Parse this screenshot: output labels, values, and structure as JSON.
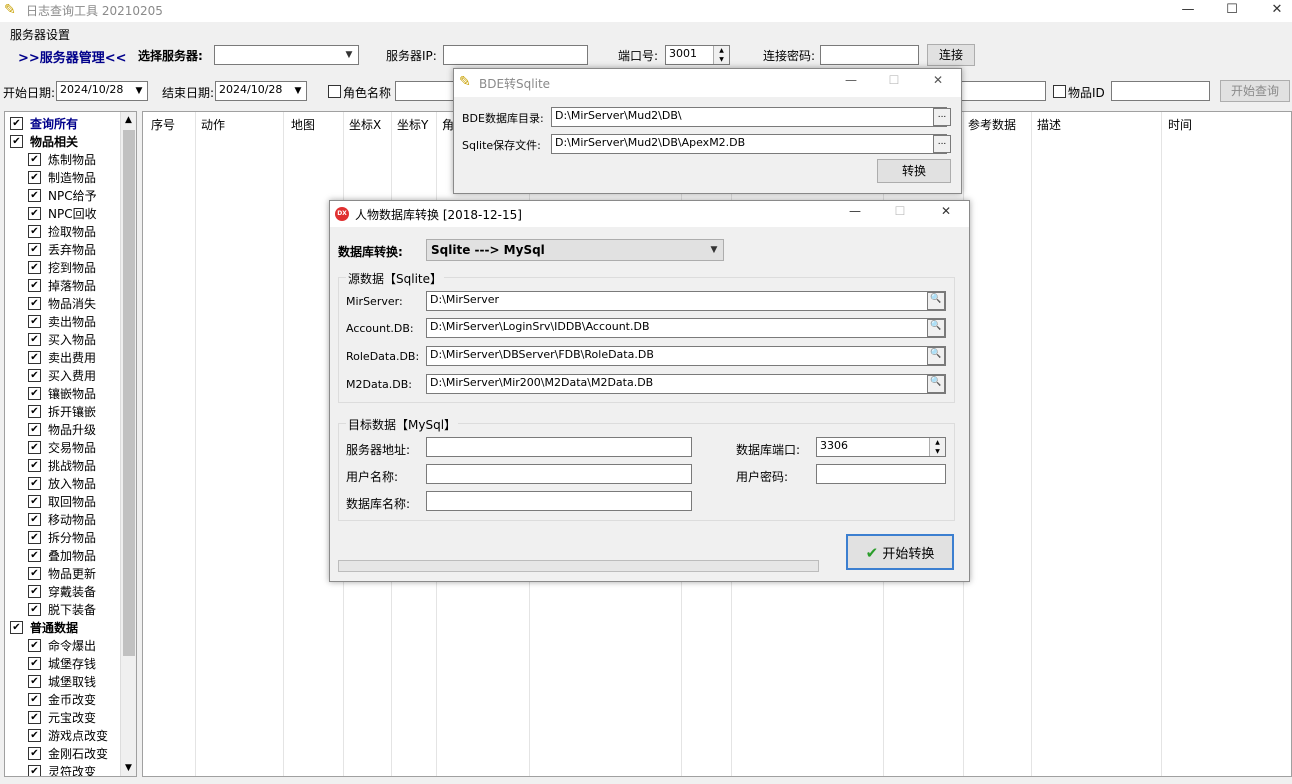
{
  "app": {
    "title": "日志查询工具 20210205",
    "menu": [
      "服务器设置"
    ]
  },
  "toolbar": {
    "server_mgmt_link": ">>服务器管理<<",
    "select_server_label": "选择服务器:",
    "select_server_value": "",
    "server_ip_label": "服务器IP:",
    "server_ip_value": "",
    "port_label": "端口号:",
    "port_value": "3001",
    "password_label": "连接密码:",
    "password_value": "",
    "connect_button": "连接"
  },
  "filters": {
    "start_date_label": "开始日期:",
    "start_date_value": "2024/10/28",
    "end_date_label": "结束日期:",
    "end_date_value": "2024/10/28",
    "role_name_label": "角色名称",
    "item_id_label": "物品ID",
    "query_button": "开始查询"
  },
  "tree": {
    "items": [
      {
        "label": "查询所有",
        "level": 0,
        "checked": true,
        "style": "root-blue"
      },
      {
        "label": "物品相关",
        "level": 0,
        "checked": true,
        "style": "group"
      },
      {
        "label": "炼制物品",
        "level": 1,
        "checked": true
      },
      {
        "label": "制造物品",
        "level": 1,
        "checked": true
      },
      {
        "label": "NPC给予",
        "level": 1,
        "checked": true
      },
      {
        "label": "NPC回收",
        "level": 1,
        "checked": true
      },
      {
        "label": "捡取物品",
        "level": 1,
        "checked": true
      },
      {
        "label": "丢弃物品",
        "level": 1,
        "checked": true
      },
      {
        "label": "挖到物品",
        "level": 1,
        "checked": true
      },
      {
        "label": "掉落物品",
        "level": 1,
        "checked": true
      },
      {
        "label": "物品消失",
        "level": 1,
        "checked": true
      },
      {
        "label": "卖出物品",
        "level": 1,
        "checked": true
      },
      {
        "label": "买入物品",
        "level": 1,
        "checked": true
      },
      {
        "label": "卖出费用",
        "level": 1,
        "checked": true
      },
      {
        "label": "买入费用",
        "level": 1,
        "checked": true
      },
      {
        "label": "镶嵌物品",
        "level": 1,
        "checked": true
      },
      {
        "label": "拆开镶嵌",
        "level": 1,
        "checked": true
      },
      {
        "label": "物品升级",
        "level": 1,
        "checked": true
      },
      {
        "label": "交易物品",
        "level": 1,
        "checked": true
      },
      {
        "label": "挑战物品",
        "level": 1,
        "checked": true
      },
      {
        "label": "放入物品",
        "level": 1,
        "checked": true
      },
      {
        "label": "取回物品",
        "level": 1,
        "checked": true
      },
      {
        "label": "移动物品",
        "level": 1,
        "checked": true
      },
      {
        "label": "拆分物品",
        "level": 1,
        "checked": true
      },
      {
        "label": "叠加物品",
        "level": 1,
        "checked": true
      },
      {
        "label": "物品更新",
        "level": 1,
        "checked": true
      },
      {
        "label": "穿戴装备",
        "level": 1,
        "checked": true
      },
      {
        "label": "脱下装备",
        "level": 1,
        "checked": true
      },
      {
        "label": "普通数据",
        "level": 0,
        "checked": true,
        "style": "group"
      },
      {
        "label": "命令爆出",
        "level": 1,
        "checked": true
      },
      {
        "label": "城堡存钱",
        "level": 1,
        "checked": true
      },
      {
        "label": "城堡取钱",
        "level": 1,
        "checked": true
      },
      {
        "label": "金币改变",
        "level": 1,
        "checked": true
      },
      {
        "label": "元宝改变",
        "level": 1,
        "checked": true
      },
      {
        "label": "游戏点改变",
        "level": 1,
        "checked": true
      },
      {
        "label": "金刚石改变",
        "level": 1,
        "checked": true
      },
      {
        "label": "灵符改变",
        "level": 1,
        "checked": true
      }
    ]
  },
  "grid": {
    "columns": [
      "序号",
      "动作",
      "地图",
      "坐标X",
      "坐标Y",
      "角",
      "参考数据",
      "描述",
      "时间"
    ]
  },
  "bde_dialog": {
    "title": "BDE转Sqlite",
    "bde_dir_label": "BDE数据库目录:",
    "bde_dir_value": "D:\\MirServer\\Mud2\\DB\\",
    "sqlite_file_label": "Sqlite保存文件:",
    "sqlite_file_value": "D:\\MirServer\\Mud2\\DB\\ApexM2.DB",
    "convert_button": "转换"
  },
  "convert_dialog": {
    "title": "人物数据库转换 [2018-12-15]",
    "mode_label": "数据库转换:",
    "mode_value": "Sqlite ---> MySql",
    "source_legend": "源数据【Sqlite】",
    "source_fields": [
      {
        "label": "MirServer:",
        "value": "D:\\MirServer"
      },
      {
        "label": "Account.DB:",
        "value": "D:\\MirServer\\LoginSrv\\IDDB\\Account.DB"
      },
      {
        "label": "RoleData.DB:",
        "value": "D:\\MirServer\\DBServer\\FDB\\RoleData.DB"
      },
      {
        "label": "M2Data.DB:",
        "value": "D:\\MirServer\\Mir200\\M2Data\\M2Data.DB"
      }
    ],
    "target_legend": "目标数据【MySql】",
    "server_addr_label": "服务器地址:",
    "server_addr_value": "",
    "db_port_label": "数据库端口:",
    "db_port_value": "3306",
    "username_label": "用户名称:",
    "username_value": "",
    "user_password_label": "用户密码:",
    "user_password_value": "",
    "db_name_label": "数据库名称:",
    "db_name_value": "",
    "start_button": "开始转换",
    "progress": 0
  }
}
